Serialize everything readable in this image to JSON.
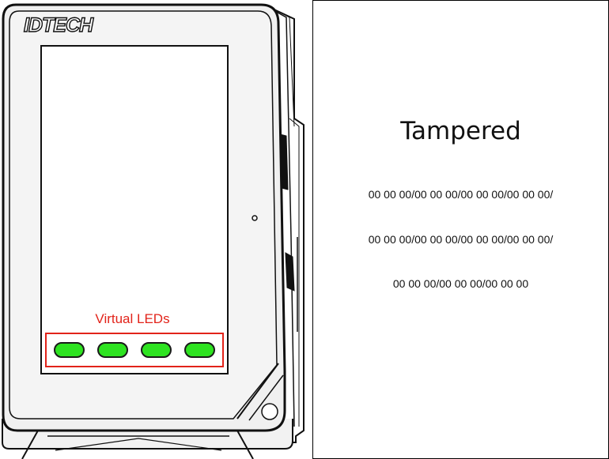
{
  "device": {
    "brand": "IDTECH",
    "virtual_leds_label": "Virtual LEDs",
    "led_color": "#2ee321",
    "highlight_color": "#e2231a",
    "leds": [
      {
        "state": "on"
      },
      {
        "state": "on"
      },
      {
        "state": "on"
      },
      {
        "state": "on"
      }
    ]
  },
  "status": {
    "title": "Tampered",
    "lines": [
      "00 00 00/00 00 00/00 00 00/00 00 00/",
      "00 00 00/00 00 00/00 00 00/00 00 00/",
      "00 00 00/00 00 00/00 00 00"
    ]
  }
}
